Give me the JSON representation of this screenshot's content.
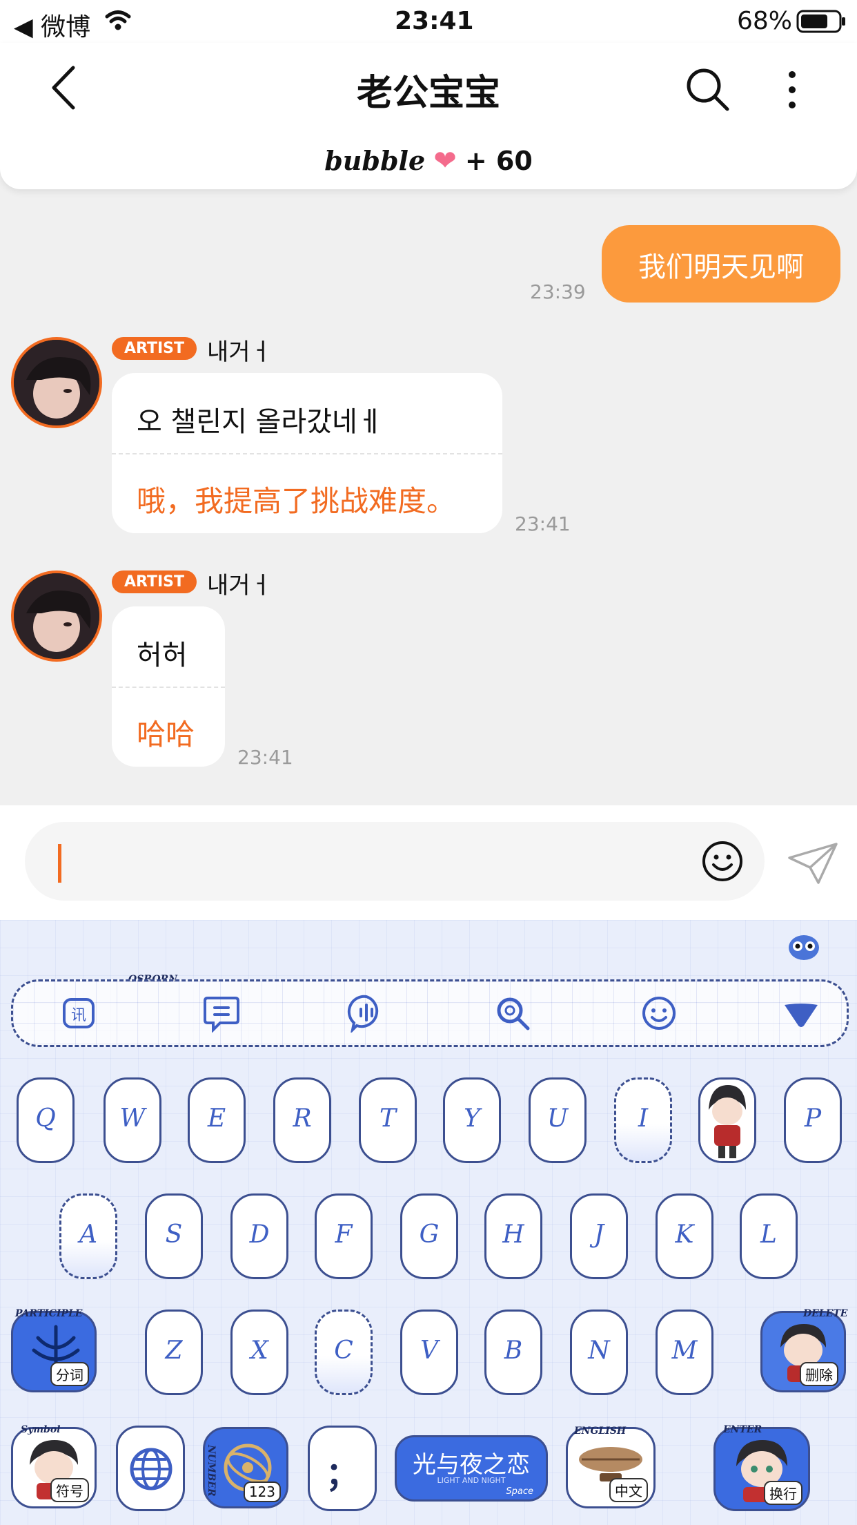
{
  "status_bar": {
    "back_app": "◀ 微博",
    "time": "23:41",
    "battery": "68%"
  },
  "header": {
    "title": "老公宝宝",
    "brand": "bubble",
    "heart": "❤",
    "count": "+ 60"
  },
  "messages": [
    {
      "from": "me",
      "text": "我们明天见啊",
      "time": "23:39"
    },
    {
      "from": "artist",
      "badge": "ARTIST",
      "name": "내거ㅓ",
      "korean": "오 챌린지 올라갔네ㅔ",
      "translation": "哦，我提高了挑战难度。",
      "time": "23:41"
    },
    {
      "from": "artist",
      "badge": "ARTIST",
      "name": "내거ㅓ",
      "korean": "허허",
      "translation": "哈哈",
      "time": "23:41"
    }
  ],
  "input": {
    "placeholder": ""
  },
  "keyboard": {
    "toolbar_label": "OSBORN",
    "row1": [
      "Q",
      "W",
      "E",
      "R",
      "T",
      "Y",
      "U",
      "I",
      "",
      "P"
    ],
    "row2": [
      "A",
      "S",
      "D",
      "F",
      "G",
      "H",
      "J",
      "K",
      "L"
    ],
    "row3": [
      "Z",
      "X",
      "C",
      "V",
      "B",
      "N",
      "M"
    ],
    "participle": {
      "tag": "PARTICIPLE",
      "label": "分词"
    },
    "delete": {
      "tag": "DELETE",
      "label": "删除"
    },
    "symbol": {
      "tag": "Symbol",
      "label": "符号"
    },
    "number": {
      "tag": "NUMBER",
      "label": "123"
    },
    "semicolon": "；",
    "space": {
      "title": "光与夜之恋",
      "sub": "LIGHT AND NIGHT",
      "tag": "Space"
    },
    "english": {
      "tag": "ENGLISH",
      "label": "中文"
    },
    "enter": {
      "tag": "ENTER",
      "label": "换行"
    }
  },
  "colors": {
    "accent": "#f26b21",
    "my_bubble": "#fc9a3d",
    "key_blue": "#3e5fc4"
  }
}
